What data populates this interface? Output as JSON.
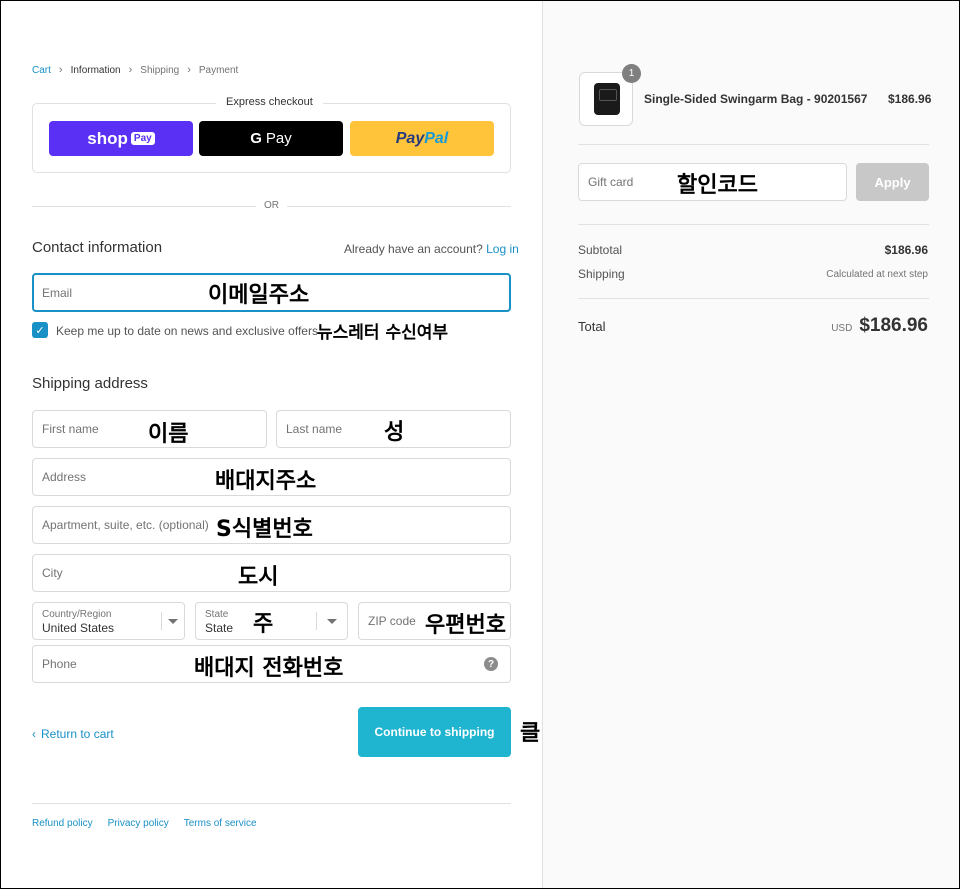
{
  "breadcrumb": {
    "cart": "Cart",
    "information": "Information",
    "shipping": "Shipping",
    "payment": "Payment"
  },
  "express": {
    "title": "Express checkout",
    "shop_pay": "shop",
    "shop_pay_badge": "Pay",
    "google_pay_g": "G",
    "google_pay": "Pay",
    "paypal_a": "Pay",
    "paypal_b": "Pal",
    "or": "OR"
  },
  "contact": {
    "title": "Contact information",
    "have_account": "Already have an account?",
    "login": "Log in",
    "email_placeholder": "Email",
    "newsletter": "Keep me up to date on news and exclusive offers"
  },
  "shipping": {
    "title": "Shipping address",
    "first_name": "First name",
    "last_name": "Last name",
    "address": "Address",
    "apartment": "Apartment, suite, etc. (optional)",
    "city": "City",
    "country_label": "Country/Region",
    "country_value": "United States",
    "state_label": "State",
    "state_value": "State",
    "zip": "ZIP code",
    "phone": "Phone"
  },
  "actions": {
    "return": "Return to cart",
    "continue": "Continue to shipping"
  },
  "footer": {
    "refund": "Refund policy",
    "privacy": "Privacy policy",
    "terms": "Terms of service"
  },
  "annotations": {
    "email": "이메일주소",
    "newsletter": "뉴스레터 수신여부",
    "first_name": "이름",
    "last_name": "성",
    "address": "배대지주소",
    "apartment": "S식별번호",
    "city": "도시",
    "state": "주",
    "zip": "우편번호",
    "phone": "배대지 전화번호",
    "click": "클릭",
    "gift": "할인코드"
  },
  "order": {
    "quantity": "1",
    "product_name": "Single-Sided Swingarm Bag - 90201567",
    "product_price": "$186.96",
    "gift_placeholder": "Gift card",
    "apply": "Apply",
    "subtotal_label": "Subtotal",
    "subtotal_value": "$186.96",
    "shipping_label": "Shipping",
    "shipping_value": "Calculated at next step",
    "total_label": "Total",
    "currency": "USD",
    "total_value": "$186.96"
  },
  "colors": {
    "accent": "#1990c6",
    "continue_button": "#1fb4cf",
    "shop_pay": "#5a31f4",
    "paypal": "#ffc439"
  }
}
